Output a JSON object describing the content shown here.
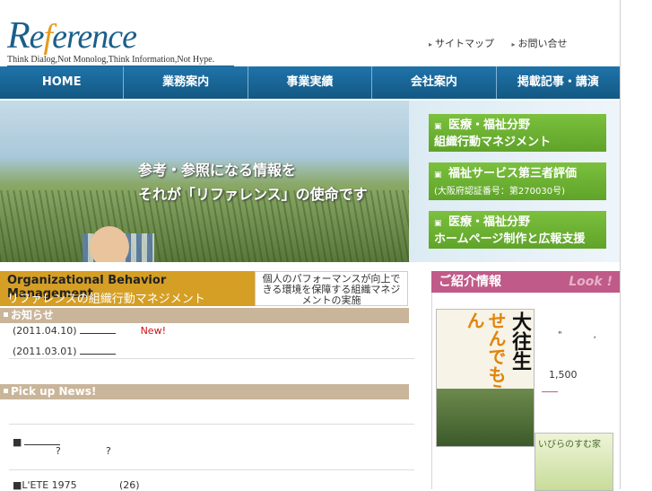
{
  "header": {
    "logo_r": "R",
    "logo_e": "e",
    "logo_f": "f",
    "logo_rest": "erence",
    "tagline": "Think Dialog,Not Monolog,Think Information,Not Hype.",
    "links": [
      "サイトマップ",
      "お問い合せ"
    ]
  },
  "nav": [
    "HOME",
    "業務案内",
    "事業実績",
    "会社案内",
    "掲載記事・講演"
  ],
  "hero": {
    "caption_line1": "参考・参照になる情報を",
    "caption_line2": "それが「リファレンス」の使命です"
  },
  "side_buttons": [
    {
      "line1": "医療・福祉分野",
      "line2": "組織行動マネジメント",
      "sub": ""
    },
    {
      "line1": "福祉サービス第三者評価",
      "line2": "",
      "sub": "(大阪府認証番号：第270030号)"
    },
    {
      "line1": "医療・福祉分野",
      "line2": "ホームページ制作と広報支援",
      "sub": ""
    }
  ],
  "obm": {
    "title_en": "Organizational Behavior Management",
    "title_ja": "リファレンスの組織行動マネジメント",
    "desc": "個人のパフォーマンスが向上できる環境を保障する組織マネジメントの実施"
  },
  "news": {
    "heading": "お知らせ",
    "items": [
      {
        "date": "(2011.04.10)",
        "badge": "New!"
      },
      {
        "date": "(2011.03.01)",
        "badge": ""
      }
    ]
  },
  "pickup": {
    "heading": "Pick up News!",
    "row1_mark": "■",
    "row1_q1": "?",
    "row1_q2": "?",
    "row2_text": "■L'ETE 1975",
    "row2_count": "(26)"
  },
  "intro": {
    "heading": "ご紹介情報",
    "look": "Look !",
    "book1_orange": "せんでもええやん",
    "book1_black": "大往生",
    "book2_title": "いびらのすむ家",
    "price": "1,500",
    "quote_open": "\"",
    "quote_close": ","
  },
  "colors": {
    "nav": "#1f73aa",
    "green": "#6ab233",
    "gold": "#d59f25",
    "pink": "#c05a88",
    "tan": "#c9b59a"
  }
}
